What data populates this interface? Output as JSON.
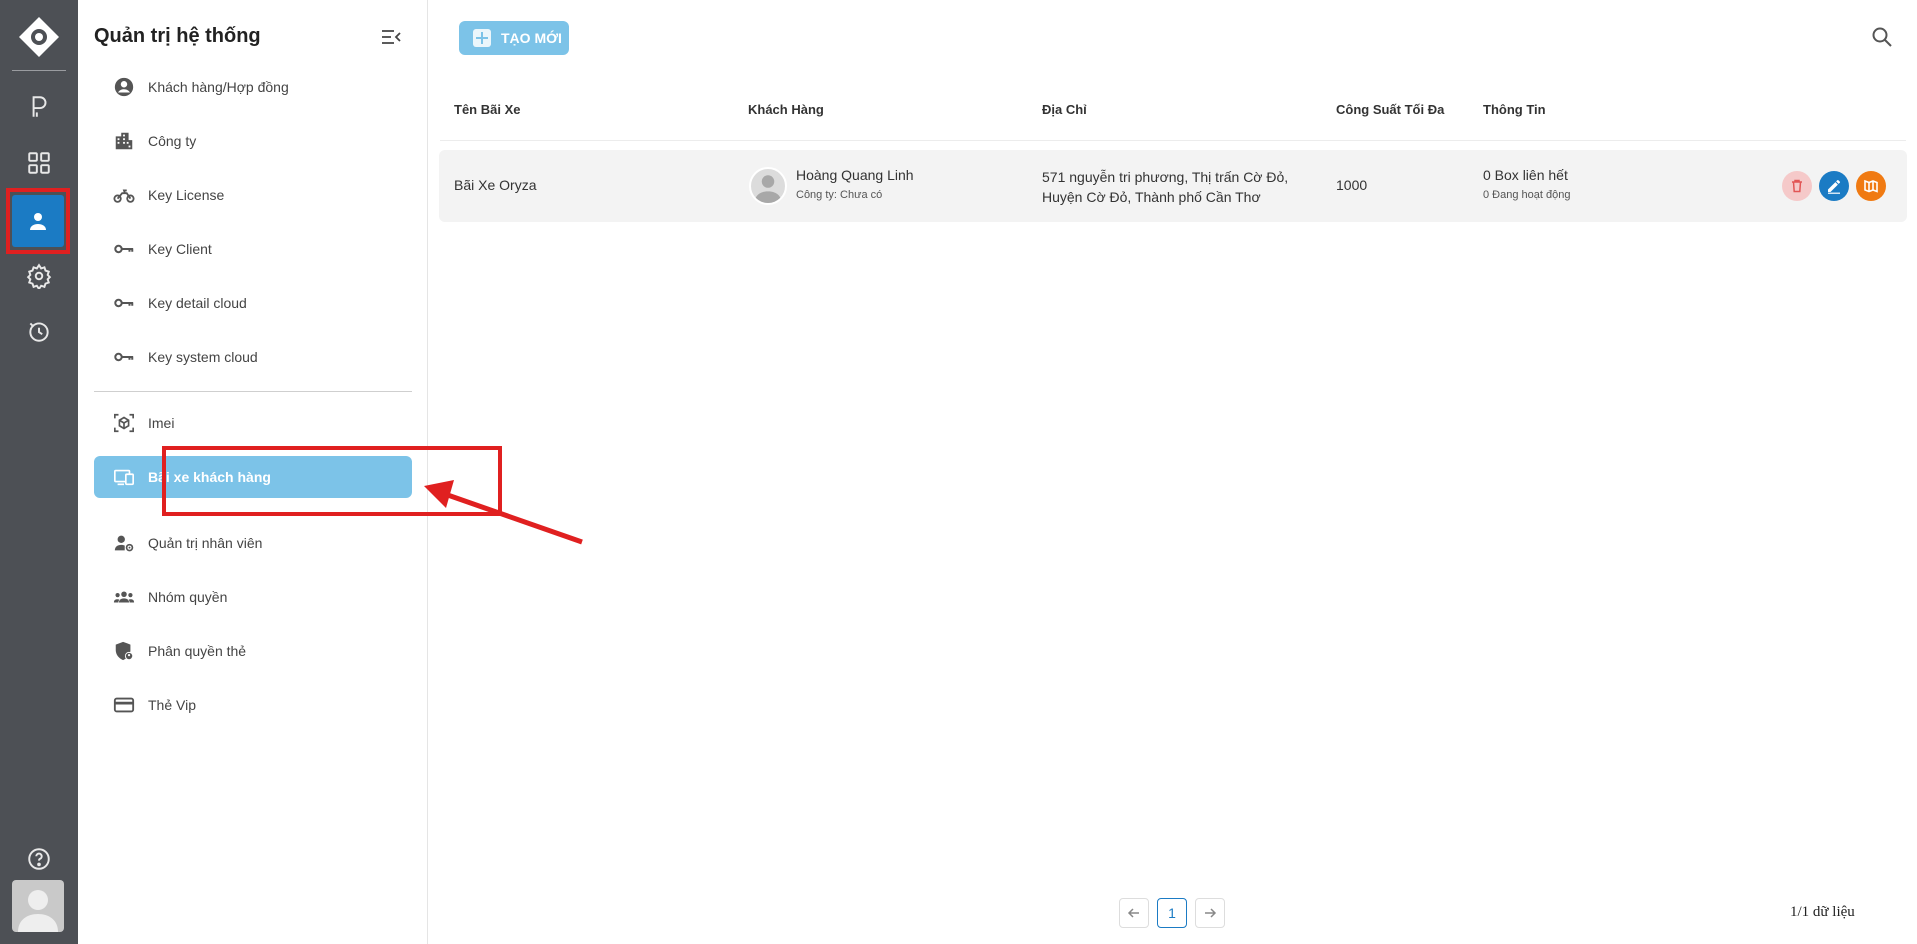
{
  "rail": {
    "items": [
      {
        "name": "parking-p-icon"
      },
      {
        "name": "grid-icon"
      },
      {
        "name": "user-icon",
        "active": true
      },
      {
        "name": "gear-icon"
      },
      {
        "name": "history-icon"
      }
    ],
    "help_icon": "help-icon"
  },
  "sidebar": {
    "title": "Quản trị hệ thống",
    "items": [
      {
        "label": "Khách hàng/Hợp đồng",
        "icon": "account-circle-icon"
      },
      {
        "label": "Công ty",
        "icon": "building-icon"
      },
      {
        "label": "Key License",
        "icon": "motorcycle-icon"
      },
      {
        "label": "Key Client",
        "icon": "key-icon"
      },
      {
        "label": "Key detail cloud",
        "icon": "key-icon"
      },
      {
        "label": "Key system cloud",
        "icon": "key-icon"
      },
      {
        "label": "Imei",
        "icon": "cube-scan-icon"
      },
      {
        "label": "Bãi xe khách hàng",
        "icon": "devices-icon",
        "active": true
      },
      {
        "label": "Quản trị nhân viên",
        "icon": "user-settings-icon"
      },
      {
        "label": "Nhóm quyền",
        "icon": "group-icon"
      },
      {
        "label": "Phân quyền thẻ",
        "icon": "shield-user-icon"
      },
      {
        "label": "Thẻ Vip",
        "icon": "credit-card-icon"
      }
    ]
  },
  "toolbar": {
    "create_label": "TẠO MỚI"
  },
  "table": {
    "columns": [
      "Tên Bãi Xe",
      "Khách Hàng",
      "Địa Chỉ",
      "Công Suất Tối Đa",
      "Thông Tin"
    ],
    "rows": [
      {
        "name": "Bãi Xe Oryza",
        "customer": "Hoàng Quang Linh",
        "company": "Công ty: Chưa có",
        "address_line1": "571 nguyễn tri phương, Thị trấn Cờ Đỏ,",
        "address_line2": "Huyện Cờ Đỏ, Thành phố Cần Thơ",
        "capacity": "1000",
        "info_line1": "0 Box liên hết",
        "info_line2": "0 Đang hoạt động"
      }
    ]
  },
  "pagination": {
    "current_page": "1",
    "summary": "1/1 dữ liệu"
  },
  "colors": {
    "accent": "#1b7bc4",
    "active_menu": "#7cc3e8",
    "highlight": "#e02020",
    "rail_bg": "#4d5055",
    "delete": "#f5c9c9",
    "map": "#f07a12"
  }
}
